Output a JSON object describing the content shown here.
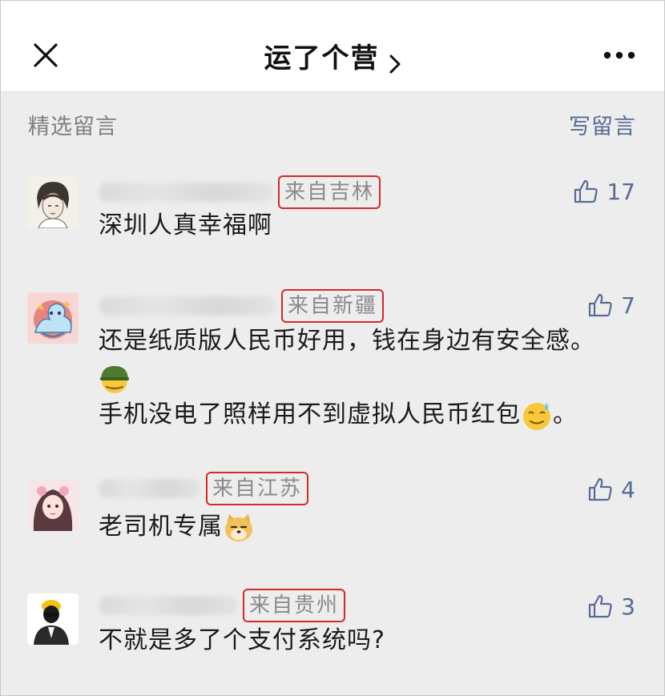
{
  "header": {
    "title": "运了个营",
    "close_icon": "close-icon",
    "more_icon": "more-icon"
  },
  "section": {
    "label": "精选留言",
    "write_label": "写留言"
  },
  "colors": {
    "link": "#576b95",
    "highlight_box": "#d42a2a",
    "background": "#ededed"
  },
  "comments": [
    {
      "location": "来自吉林",
      "likes": "17",
      "lines": [
        "深圳人真幸福啊"
      ]
    },
    {
      "location": "来自新疆",
      "likes": "7",
      "lines": [
        "还是纸质版人民币好用，钱在身边有安全感。",
        "手机没电了照样用不到虚拟人民币红包",
        "。"
      ]
    },
    {
      "location": "来自江苏",
      "likes": "4",
      "lines": [
        "老司机专属"
      ]
    },
    {
      "location": "来自贵州",
      "likes": "3",
      "lines": [
        "不就是多了个支付系统吗?"
      ]
    }
  ]
}
